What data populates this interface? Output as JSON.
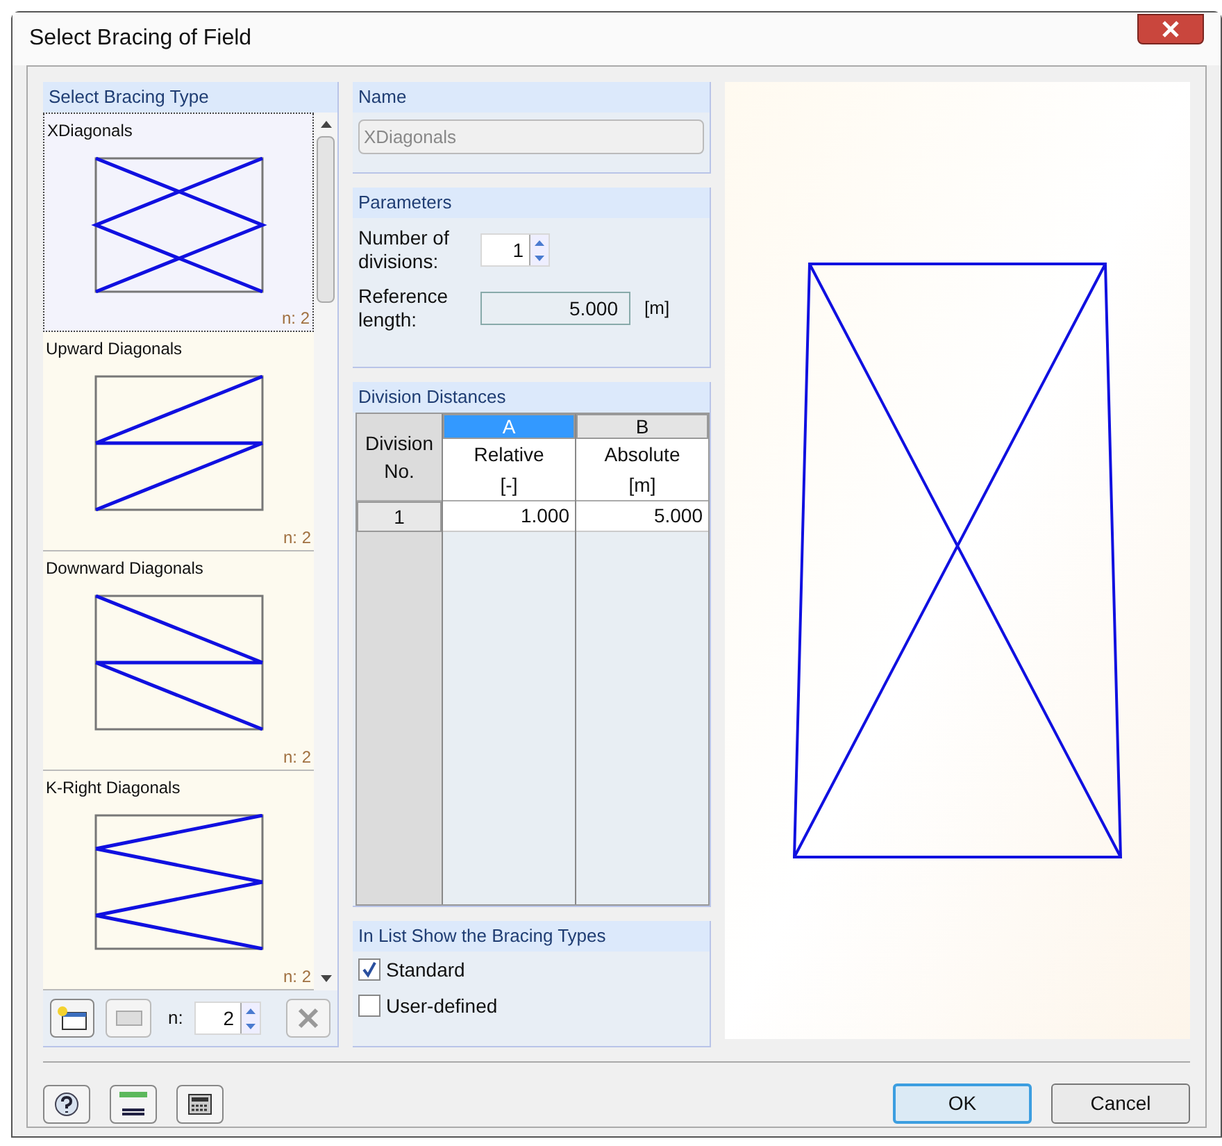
{
  "window": {
    "title": "Select Bracing of Field"
  },
  "bracing_types": {
    "title": "Select Bracing Type",
    "items": [
      {
        "label": "XDiagonals",
        "count": "n: 2",
        "kind": "x",
        "selected": true
      },
      {
        "label": "Upward Diagonals",
        "count": "n: 2",
        "kind": "upward",
        "selected": false
      },
      {
        "label": "Downward Diagonals",
        "count": "n: 2",
        "kind": "downward",
        "selected": false
      },
      {
        "label": "K-Right Diagonals",
        "count": "n: 2",
        "kind": "k-right",
        "selected": false
      }
    ],
    "n_label": "n:",
    "n_value": "2"
  },
  "name": {
    "title": "Name",
    "value": "XDiagonals"
  },
  "parameters": {
    "title": "Parameters",
    "divisions_label": "Number of divisions:",
    "divisions_value": "1",
    "length_label": "Reference length:",
    "length_value": "5.000",
    "length_unit": "[m]"
  },
  "division_distances": {
    "title": "Division Distances",
    "row_header": "Division No.",
    "columns": [
      {
        "letter": "A",
        "name": "Relative",
        "unit": "[-]",
        "selected": true
      },
      {
        "letter": "B",
        "name": "Absolute",
        "unit": "[m]",
        "selected": false
      }
    ],
    "rows": [
      {
        "no": "1",
        "cells": [
          "1.000",
          "5.000"
        ]
      }
    ]
  },
  "show_types": {
    "title": "In List Show the Bracing Types",
    "options": [
      {
        "label": "Standard",
        "checked": true
      },
      {
        "label": "User-defined",
        "checked": false
      }
    ]
  },
  "buttons": [
    {
      "label": "OK",
      "default": true
    },
    {
      "label": "Cancel",
      "default": false
    }
  ]
}
